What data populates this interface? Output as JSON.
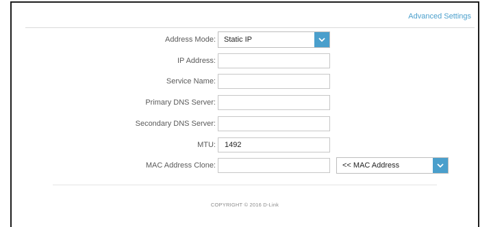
{
  "header": {
    "advanced_settings_link": "Advanced Settings"
  },
  "form": {
    "address_mode": {
      "label": "Address Mode:",
      "value": "Static IP"
    },
    "ip_address": {
      "label": "IP Address:",
      "value": ""
    },
    "service_name": {
      "label": "Service Name:",
      "value": ""
    },
    "primary_dns": {
      "label": "Primary DNS Server:",
      "value": ""
    },
    "secondary_dns": {
      "label": "Secondary DNS Server:",
      "value": ""
    },
    "mtu": {
      "label": "MTU:",
      "value": "1492"
    },
    "mac_clone": {
      "label": "MAC Address Clone:",
      "value": "",
      "select_value": "<< MAC Address"
    }
  },
  "footer": {
    "copyright": "COPYRIGHT © 2016 D-Link"
  },
  "colors": {
    "accent": "#4a9fcc",
    "frame_border": "#1a1a1a",
    "label_text": "#5a5a5a"
  },
  "icons": {
    "select_arrow": "chevron-down-icon"
  }
}
